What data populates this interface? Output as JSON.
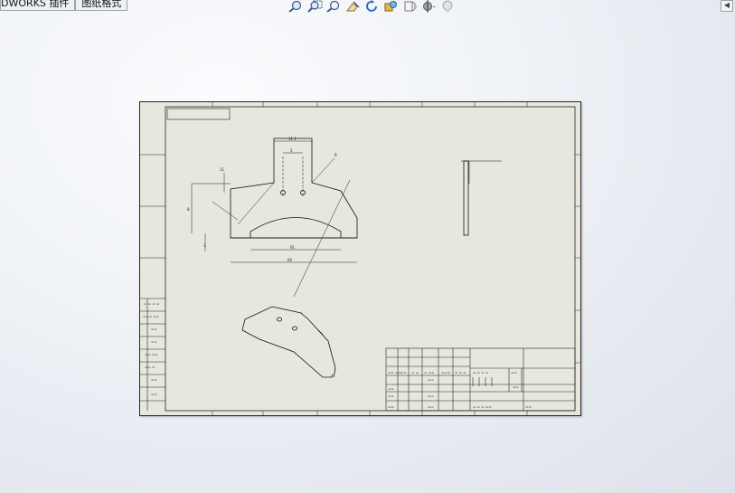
{
  "tabs": [
    {
      "label": "DWORKS 插件"
    },
    {
      "label": "图纸格式"
    }
  ],
  "toolbar": {
    "icons": [
      "zoom-to-fit-icon",
      "zoom-to-area-icon",
      "zoom-in-out-icon",
      "select-icon",
      "rotate-icon",
      "display-style-icon",
      "view-orientation-icon",
      "hide-show-icon",
      "appearance-icon"
    ]
  },
  "drawing": {
    "dim_values": [
      "11.1",
      "5",
      "11",
      "60",
      "R",
      "8",
      "91",
      "3"
    ]
  }
}
